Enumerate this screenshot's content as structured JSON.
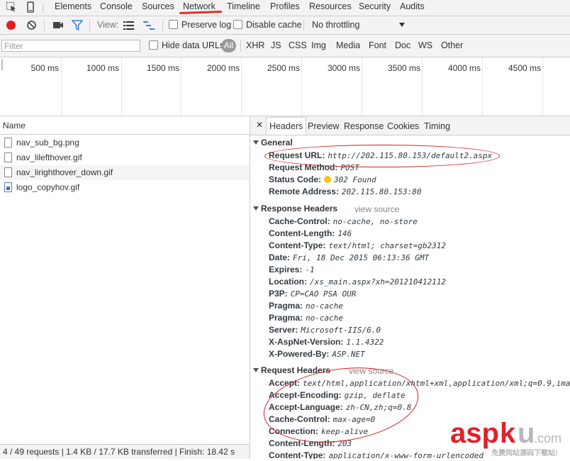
{
  "tabs": [
    "Elements",
    "Console",
    "Sources",
    "Network",
    "Timeline",
    "Profiles",
    "Resources",
    "Security",
    "Audits"
  ],
  "toolbar": {
    "view_label": "View:",
    "preserve_log": "Preserve log",
    "disable_cache": "Disable cache",
    "throttling": "No throttling"
  },
  "filterbar": {
    "filter_placeholder": "Filter",
    "hide_data_urls": "Hide data URLs",
    "all": "All",
    "types": [
      "XHR",
      "JS",
      "CSS",
      "Img",
      "Media",
      "Font",
      "Doc",
      "WS",
      "Other"
    ]
  },
  "timeline": {
    "ticks": [
      "500 ms",
      "1000 ms",
      "1500 ms",
      "2000 ms",
      "2500 ms",
      "3000 ms",
      "3500 ms",
      "4000 ms",
      "4500 ms"
    ]
  },
  "requests": {
    "column_name": "Name",
    "files": [
      "nav_sub_bg.png",
      "nav_lilefthover.gif",
      "nav_lirighthover_down.gif",
      "logo_copyhov.gif"
    ],
    "status": "4 / 49 requests | 1.4 KB / 17.7 KB transferred | Finish: 18.42 s"
  },
  "details": {
    "close": "✕",
    "tabs": [
      "Headers",
      "Preview",
      "Response",
      "Cookies",
      "Timing"
    ],
    "general": {
      "title": "General",
      "rows": [
        {
          "k": "Request URL:",
          "v": "http://202.115.80.153/default2.aspx"
        },
        {
          "k": "Request Method:",
          "v": "POST"
        },
        {
          "k": "Status Code:",
          "v": "302 Found"
        },
        {
          "k": "Remote Address:",
          "v": "202.115.80.153:80"
        }
      ]
    },
    "response_headers": {
      "title": "Response Headers",
      "view_source": "view source",
      "rows": [
        {
          "k": "Cache-Control:",
          "v": "no-cache, no-store"
        },
        {
          "k": "Content-Length:",
          "v": "146"
        },
        {
          "k": "Content-Type:",
          "v": "text/html; charset=gb2312"
        },
        {
          "k": "Date:",
          "v": "Fri, 18 Dec 2015 06:13:36 GMT"
        },
        {
          "k": "Expires:",
          "v": "-1"
        },
        {
          "k": "Location:",
          "v": "/xs_main.aspx?xh=201210412112"
        },
        {
          "k": "P3P:",
          "v": "CP=CAO PSA OUR"
        },
        {
          "k": "Pragma:",
          "v": "no-cache"
        },
        {
          "k": "Pragma:",
          "v": "no-cache"
        },
        {
          "k": "Server:",
          "v": "Microsoft-IIS/6.0"
        },
        {
          "k": "X-AspNet-Version:",
          "v": "1.1.4322"
        },
        {
          "k": "X-Powered-By:",
          "v": "ASP.NET"
        }
      ]
    },
    "request_headers": {
      "title": "Request Headers",
      "view_source": "view source",
      "rows": [
        {
          "k": "Accept:",
          "v": "text/html,application/xhtml+xml,application/xml;q=0.9,ima"
        },
        {
          "k": "Accept-Encoding:",
          "v": "gzip, deflate"
        },
        {
          "k": "Accept-Language:",
          "v": "zh-CN,zh;q=0.8"
        },
        {
          "k": "Cache-Control:",
          "v": "max-age=0"
        },
        {
          "k": "Connection:",
          "v": "keep-alive"
        },
        {
          "k": "Content-Length:",
          "v": "203"
        },
        {
          "k": "Content-Type:",
          "v": "application/x-www-form-urlencoded"
        }
      ]
    }
  },
  "watermark": {
    "brand": "aspku.com",
    "sub": "免费网站源码下载站!"
  },
  "colors": {
    "record": "#e02020",
    "accent": "#3d7ee8",
    "annotation": "#d81e1e",
    "status_dot": "#f5c518"
  }
}
